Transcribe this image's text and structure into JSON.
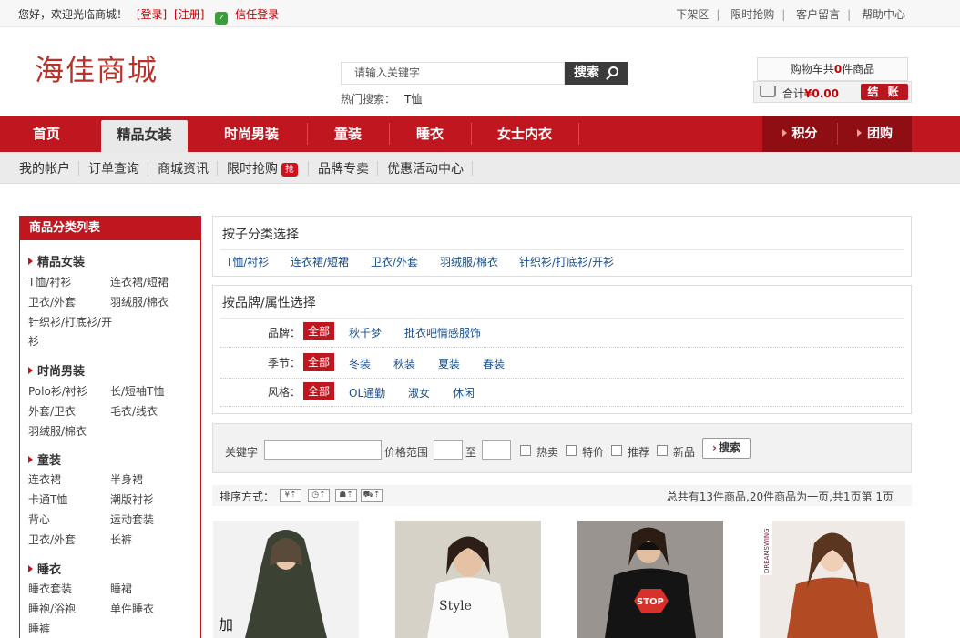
{
  "topbar": {
    "welcome": "您好，欢迎光临商城！",
    "login": "[登录]",
    "register": "[注册]",
    "trust_login": "信任登录",
    "links": [
      "下架区",
      "限时抢购",
      "客户留言",
      "帮助中心"
    ]
  },
  "header": {
    "logo": "海佳商城",
    "search_placeholder": "请输入关键字",
    "search_button": "搜索",
    "hot_label": "热门搜索：",
    "hot_keyword": "T恤",
    "cart_summary_pre": "购物车共",
    "cart_count": "0",
    "cart_summary_post": "件商品",
    "cart_total_label": "合计",
    "cart_total": "¥0.00",
    "checkout": "结 账"
  },
  "nav": {
    "items": [
      "首页",
      "精品女装",
      "时尚男装",
      "童装",
      "睡衣",
      "女士内衣"
    ],
    "right_items": [
      "积分",
      "团购"
    ]
  },
  "subnav": {
    "items": [
      "我的帐户",
      "订单查询",
      "商城资讯",
      "限时抢购",
      "品牌专卖",
      "优惠活动中心"
    ],
    "badge": "抢"
  },
  "sidebar": {
    "title": "商品分类列表",
    "categories": [
      {
        "name": "精品女装",
        "subs": [
          "T恤/衬衫",
          "连衣裙/短裙",
          "卫衣/外套",
          "羽绒服/棉衣",
          "针织衫/打底衫/开",
          "衫"
        ]
      },
      {
        "name": "时尚男装",
        "subs": [
          "Polo衫/衬衫",
          "长/短袖T恤",
          "外套/卫衣",
          "毛衣/线衣",
          "羽绒服/棉衣"
        ]
      },
      {
        "name": "童装",
        "subs": [
          "连衣裙",
          "半身裙",
          "卡通T恤",
          "潮版衬衫",
          "背心",
          "运动套装",
          "卫衣/外套",
          "长裤"
        ]
      },
      {
        "name": "睡衣",
        "subs": [
          "睡衣套装",
          "睡裙",
          "睡袍/浴袍",
          "单件睡衣",
          "睡裤"
        ]
      }
    ]
  },
  "subcat_panel": {
    "title": "按子分类选择",
    "links": [
      "T恤/衬衫",
      "连衣裙/短裙",
      "卫衣/外套",
      "羽绒服/棉衣",
      "针织衫/打底衫/开衫"
    ]
  },
  "brand_panel": {
    "title": "按品牌/属性选择",
    "rows": [
      {
        "label": "品牌：",
        "all": "全部",
        "options": [
          "秋千梦",
          "批衣吧情感服饰"
        ]
      },
      {
        "label": "季节：",
        "all": "全部",
        "options": [
          "冬装",
          "秋装",
          "夏装",
          "春装"
        ]
      },
      {
        "label": "风格：",
        "all": "全部",
        "options": [
          "OL通勤",
          "淑女",
          "休闲"
        ]
      }
    ]
  },
  "filter": {
    "keyword_label": "关键字",
    "price_label": "价格范围",
    "to_label": "至",
    "checks": [
      "热卖",
      "特价",
      "推荐",
      "新品"
    ],
    "search_button": "搜索"
  },
  "sortbar": {
    "label": "排序方式：",
    "summary": "总共有13件商品,20件商品为一页,共1页第  1页"
  },
  "products": [
    {
      "caption": "加"
    },
    {
      "caption": "Style"
    },
    {
      "caption": "STOP"
    },
    {
      "caption": "DREAMSWING"
    }
  ]
}
